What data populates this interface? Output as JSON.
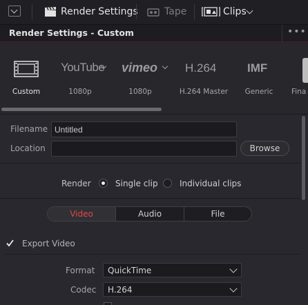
{
  "toolbar": {
    "render_settings_label": "Render Settings",
    "tape_label": "Tape",
    "clips_label": "Clips"
  },
  "panel": {
    "title": "Render Settings - Custom",
    "options_glyph": "•••"
  },
  "presets": [
    {
      "logo": "",
      "label": "Custom",
      "icon": "film-icon"
    },
    {
      "logo": "YouTube",
      "label": "1080p",
      "icon": "youtube-logo"
    },
    {
      "logo": "vimeo",
      "label": "1080p",
      "icon": "vimeo-logo"
    },
    {
      "logo": "H.264",
      "label": "H.264 Master",
      "icon": "h264-logo"
    },
    {
      "logo": "IMF",
      "label": "Generic",
      "icon": "imf-logo"
    },
    {
      "logo": "",
      "label": "Fina",
      "icon": "final-cut-logo"
    }
  ],
  "file": {
    "filename_label": "Filename",
    "filename_value": "Untitled",
    "location_label": "Location",
    "location_value": "",
    "browse_label": "Browse"
  },
  "render": {
    "label": "Render",
    "single_clip": "Single clip",
    "individual_clips": "Individual clips",
    "selected": "single_clip"
  },
  "tabs": {
    "video": "Video",
    "audio": "Audio",
    "file": "File",
    "active": "video"
  },
  "video": {
    "export_video_label": "Export Video",
    "export_video_checked": true,
    "format_label": "Format",
    "format_value": "QuickTime",
    "codec_label": "Codec",
    "codec_value": "H.264"
  },
  "colors": {
    "accent_red": "#e4474a",
    "header_divider": "#541b20"
  }
}
